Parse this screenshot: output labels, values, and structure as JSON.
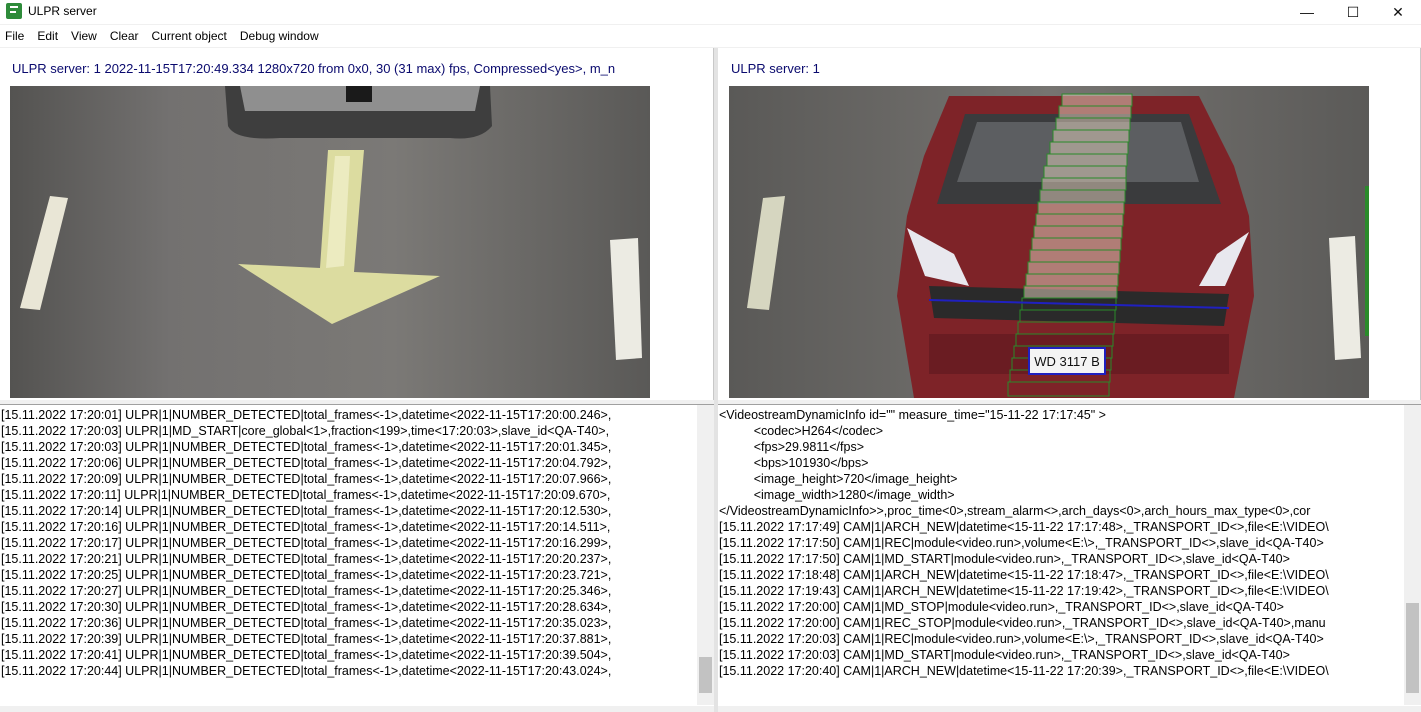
{
  "window": {
    "title": "ULPR server",
    "icon": "app-icon",
    "controls": {
      "minimize": "—",
      "maximize": "☐",
      "close": "✕"
    }
  },
  "menu": [
    "File",
    "Edit",
    "View",
    "Clear",
    "Current object",
    "Debug window"
  ],
  "left_pane": {
    "caption": "ULPR server: 1 2022-11-15T17:20:49.334 1280x720 from 0x0, 30 (31 max) fps, Compressed<yes>, m_n"
  },
  "right_pane": {
    "caption": "ULPR server: 1",
    "plate_text": "WD 3117 B"
  },
  "left_log": [
    "[15.11.2022 17:20:01] ULPR|1|NUMBER_DETECTED|total_frames<-1>,datetime<2022-11-15T17:20:00.246>,",
    "[15.11.2022 17:20:03] ULPR|1|MD_START|core_global<1>,fraction<199>,time<17:20:03>,slave_id<QA-T40>,",
    "[15.11.2022 17:20:03] ULPR|1|NUMBER_DETECTED|total_frames<-1>,datetime<2022-11-15T17:20:01.345>,",
    "[15.11.2022 17:20:06] ULPR|1|NUMBER_DETECTED|total_frames<-1>,datetime<2022-11-15T17:20:04.792>,",
    "[15.11.2022 17:20:09] ULPR|1|NUMBER_DETECTED|total_frames<-1>,datetime<2022-11-15T17:20:07.966>,",
    "[15.11.2022 17:20:11] ULPR|1|NUMBER_DETECTED|total_frames<-1>,datetime<2022-11-15T17:20:09.670>,",
    "[15.11.2022 17:20:14] ULPR|1|NUMBER_DETECTED|total_frames<-1>,datetime<2022-11-15T17:20:12.530>,",
    "[15.11.2022 17:20:16] ULPR|1|NUMBER_DETECTED|total_frames<-1>,datetime<2022-11-15T17:20:14.511>,",
    "[15.11.2022 17:20:17] ULPR|1|NUMBER_DETECTED|total_frames<-1>,datetime<2022-11-15T17:20:16.299>,",
    "[15.11.2022 17:20:21] ULPR|1|NUMBER_DETECTED|total_frames<-1>,datetime<2022-11-15T17:20:20.237>,",
    "[15.11.2022 17:20:25] ULPR|1|NUMBER_DETECTED|total_frames<-1>,datetime<2022-11-15T17:20:23.721>,",
    "[15.11.2022 17:20:27] ULPR|1|NUMBER_DETECTED|total_frames<-1>,datetime<2022-11-15T17:20:25.346>,",
    "[15.11.2022 17:20:30] ULPR|1|NUMBER_DETECTED|total_frames<-1>,datetime<2022-11-15T17:20:28.634>,",
    "[15.11.2022 17:20:36] ULPR|1|NUMBER_DETECTED|total_frames<-1>,datetime<2022-11-15T17:20:35.023>,",
    "[15.11.2022 17:20:39] ULPR|1|NUMBER_DETECTED|total_frames<-1>,datetime<2022-11-15T17:20:37.881>,",
    "[15.11.2022 17:20:41] ULPR|1|NUMBER_DETECTED|total_frames<-1>,datetime<2022-11-15T17:20:39.504>,",
    "[15.11.2022 17:20:44] ULPR|1|NUMBER_DETECTED|total_frames<-1>,datetime<2022-11-15T17:20:43.024>,"
  ],
  "right_log": [
    "<VideostreamDynamicInfo id=\"\" measure_time=\"15-11-22 17:17:45\" >",
    "          <codec>H264</codec>",
    "          <fps>29.9811</fps>",
    "          <bps>101930</bps>",
    "          <image_height>720</image_height>",
    "          <image_width>1280</image_width>",
    "</VideostreamDynamicInfo>>,proc_time<0>,stream_alarm<>,arch_days<0>,arch_hours_max_type<0>,cor",
    "[15.11.2022 17:17:49] CAM|1|ARCH_NEW|datetime<15-11-22 17:17:48>,_TRANSPORT_ID<>,file<E:\\VIDEO\\",
    "[15.11.2022 17:17:50] CAM|1|REC|module<video.run>,volume<E:\\>,_TRANSPORT_ID<>,slave_id<QA-T40>",
    "[15.11.2022 17:17:50] CAM|1|MD_START|module<video.run>,_TRANSPORT_ID<>,slave_id<QA-T40>",
    "[15.11.2022 17:18:48] CAM|1|ARCH_NEW|datetime<15-11-22 17:18:47>,_TRANSPORT_ID<>,file<E:\\VIDEO\\",
    "[15.11.2022 17:19:43] CAM|1|ARCH_NEW|datetime<15-11-22 17:19:42>,_TRANSPORT_ID<>,file<E:\\VIDEO\\",
    "[15.11.2022 17:20:00] CAM|1|MD_STOP|module<video.run>,_TRANSPORT_ID<>,slave_id<QA-T40>",
    "[15.11.2022 17:20:00] CAM|1|REC_STOP|module<video.run>,_TRANSPORT_ID<>,slave_id<QA-T40>,manu",
    "[15.11.2022 17:20:03] CAM|1|REC|module<video.run>,volume<E:\\>,_TRANSPORT_ID<>,slave_id<QA-T40>",
    "[15.11.2022 17:20:03] CAM|1|MD_START|module<video.run>,_TRANSPORT_ID<>,slave_id<QA-T40>",
    "[15.11.2022 17:20:40] CAM|1|ARCH_NEW|datetime<15-11-22 17:20:39>,_TRANSPORT_ID<>,file<E:\\VIDEO\\"
  ],
  "colors": {
    "caption": "#0a0a6e",
    "car": "#8a2a2e",
    "detection_box": "#2a8a2a",
    "plate_box": "#2020c0"
  }
}
